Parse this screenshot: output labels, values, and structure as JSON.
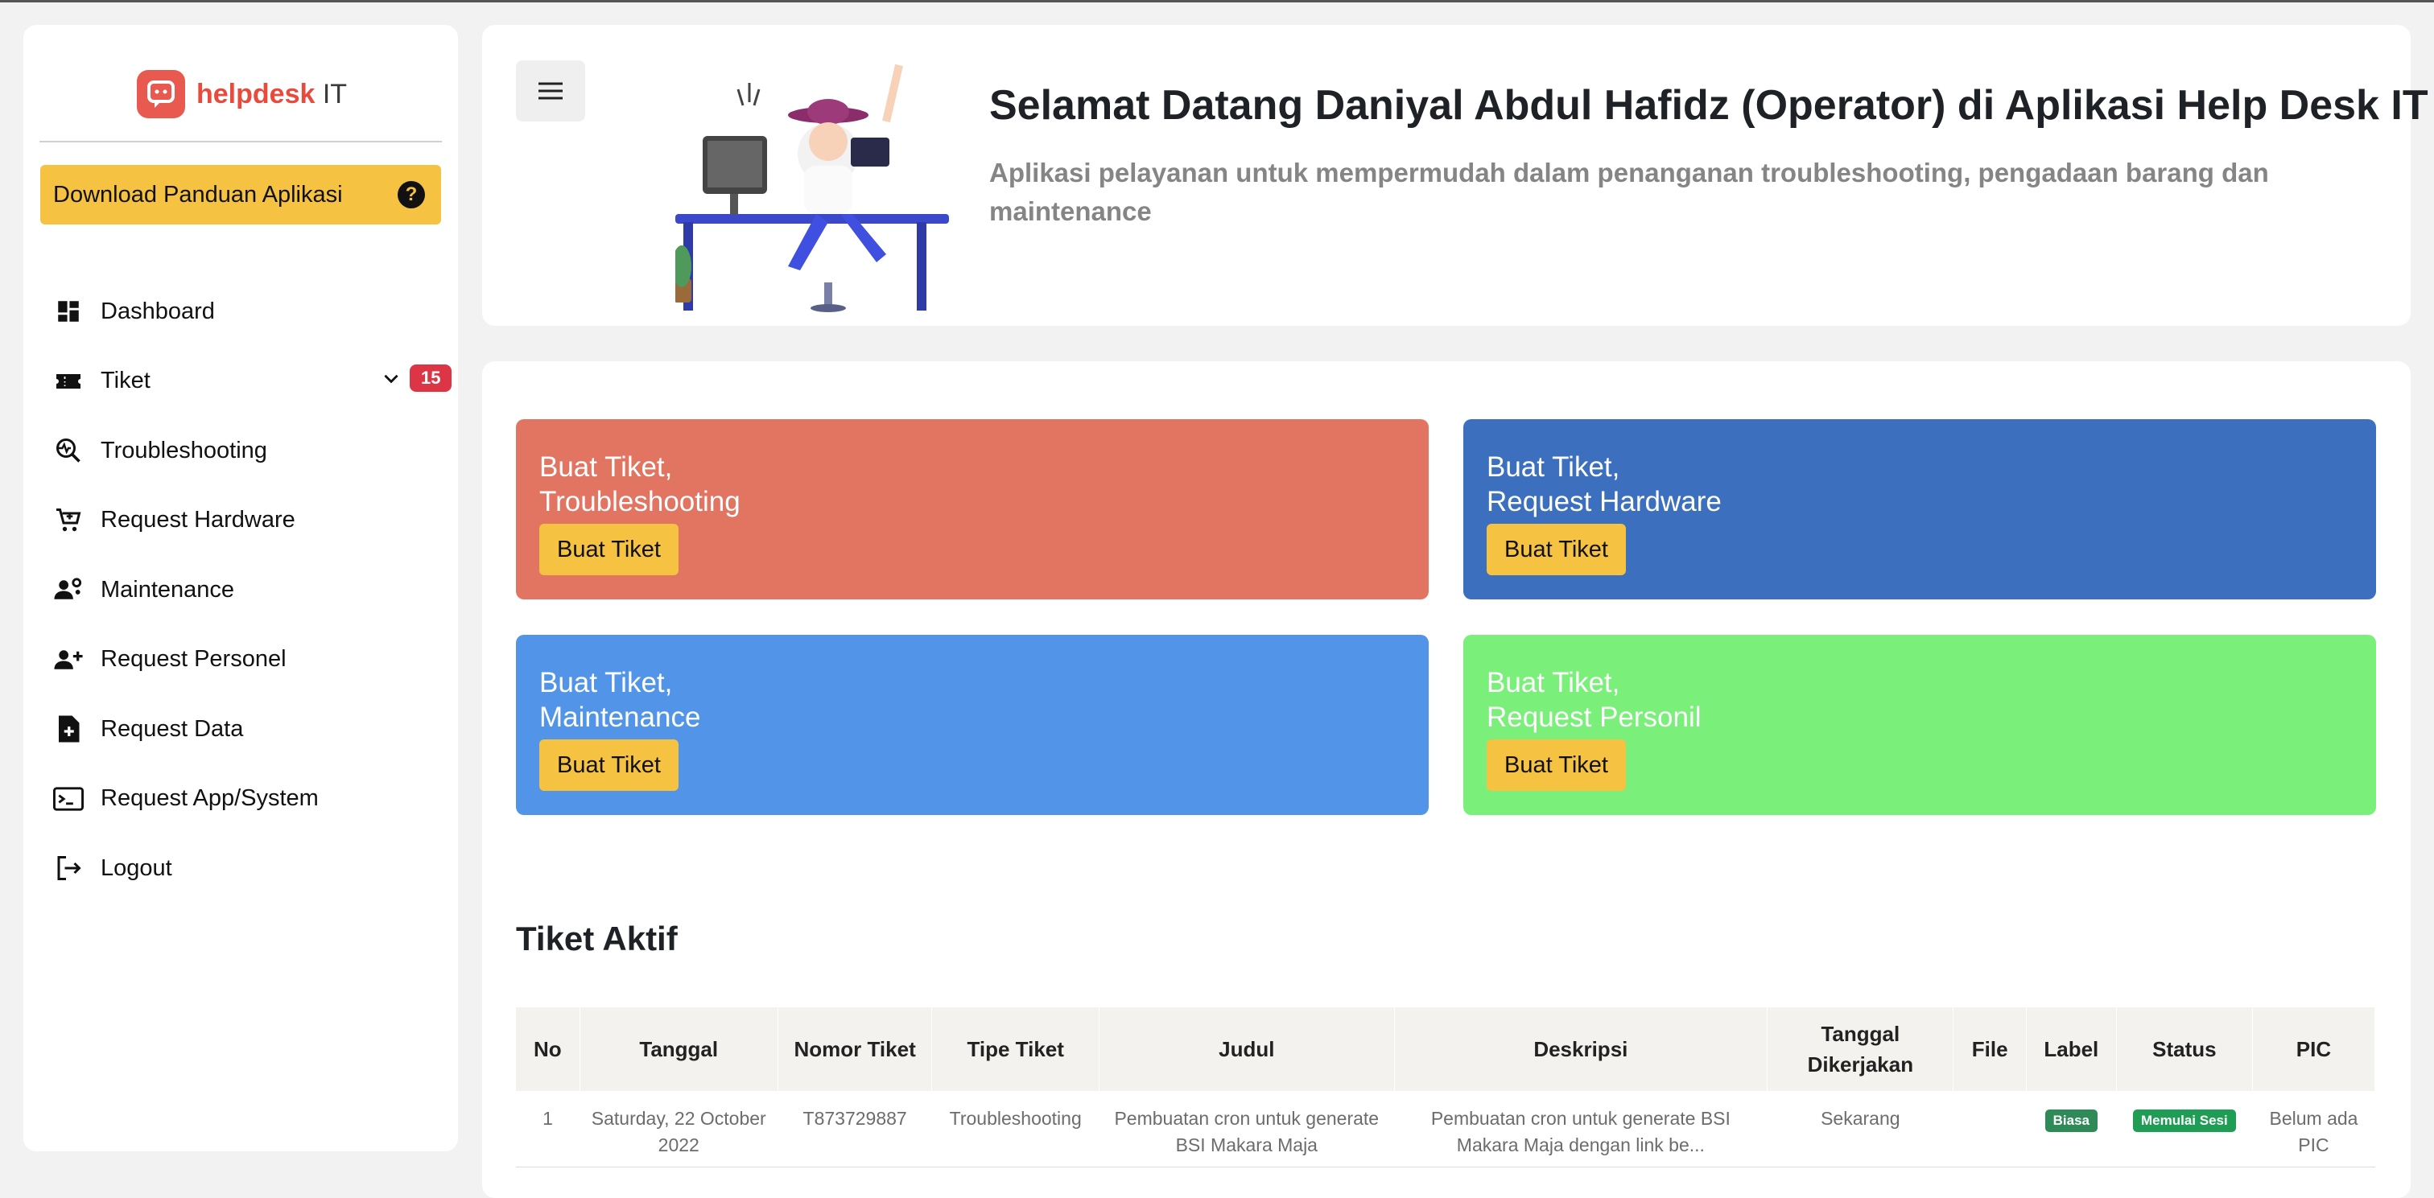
{
  "brand": {
    "name": "helpdesk",
    "suffix": "IT",
    "color": "#e84a3c"
  },
  "sidebar": {
    "download_label": "Download Panduan Aplikasi",
    "items": [
      {
        "label": "Dashboard",
        "icon": "dashboard-icon"
      },
      {
        "label": "Tiket",
        "icon": "ticket-icon",
        "badge": "15"
      },
      {
        "label": "Troubleshooting",
        "icon": "magnify-pulse-icon"
      },
      {
        "label": "Request Hardware",
        "icon": "cart-add-icon"
      },
      {
        "label": "Maintenance",
        "icon": "user-gear-icon"
      },
      {
        "label": "Request Personel",
        "icon": "user-add-icon"
      },
      {
        "label": "Request Data",
        "icon": "file-add-icon"
      },
      {
        "label": "Request App/System",
        "icon": "terminal-icon"
      },
      {
        "label": "Logout",
        "icon": "logout-icon"
      }
    ]
  },
  "hero": {
    "title": "Selamat Datang Daniyal Abdul Hafidz (Operator) di Aplikasi Help Desk IT",
    "subtitle": "Aplikasi pelayanan untuk mempermudah dalam penanganan troubleshooting, pengadaan barang dan maintenance"
  },
  "cards": [
    {
      "line1": "Buat Tiket,",
      "line2": "Troubleshooting",
      "button": "Buat Tiket",
      "color": "#e17561"
    },
    {
      "line1": "Buat Tiket,",
      "line2": "Request Hardware",
      "button": "Buat Tiket",
      "color": "#3c70bf"
    },
    {
      "line1": "Buat Tiket,",
      "line2": "Maintenance",
      "button": "Buat Tiket",
      "color": "#5295e8"
    },
    {
      "line1": "Buat Tiket,",
      "line2": "Request Personil",
      "button": "Buat Tiket",
      "color": "#7aef7a"
    }
  ],
  "active_tickets": {
    "title": "Tiket Aktif",
    "columns": [
      "No",
      "Tanggal",
      "Nomor Tiket",
      "Tipe Tiket",
      "Judul",
      "Deskripsi",
      "Tanggal Dikerjakan",
      "File",
      "Label",
      "Status",
      "PIC"
    ],
    "rows": [
      {
        "no": "1",
        "tanggal": "Saturday, 22 October 2022",
        "nomor": "T873729887",
        "tipe": "Troubleshooting",
        "judul": "Pembuatan cron untuk generate BSI Makara Maja",
        "deskripsi": "Pembuatan cron untuk generate BSI Makara Maja dengan link be...",
        "dikerjakan": "Sekarang",
        "file": "",
        "label": "Biasa",
        "status": "Memulai Sesi",
        "pic": "Belum ada PIC"
      }
    ]
  },
  "colors": {
    "accent_yellow": "#f5c242",
    "badge_red": "#dc3545",
    "label_green": "#2e8b57"
  }
}
